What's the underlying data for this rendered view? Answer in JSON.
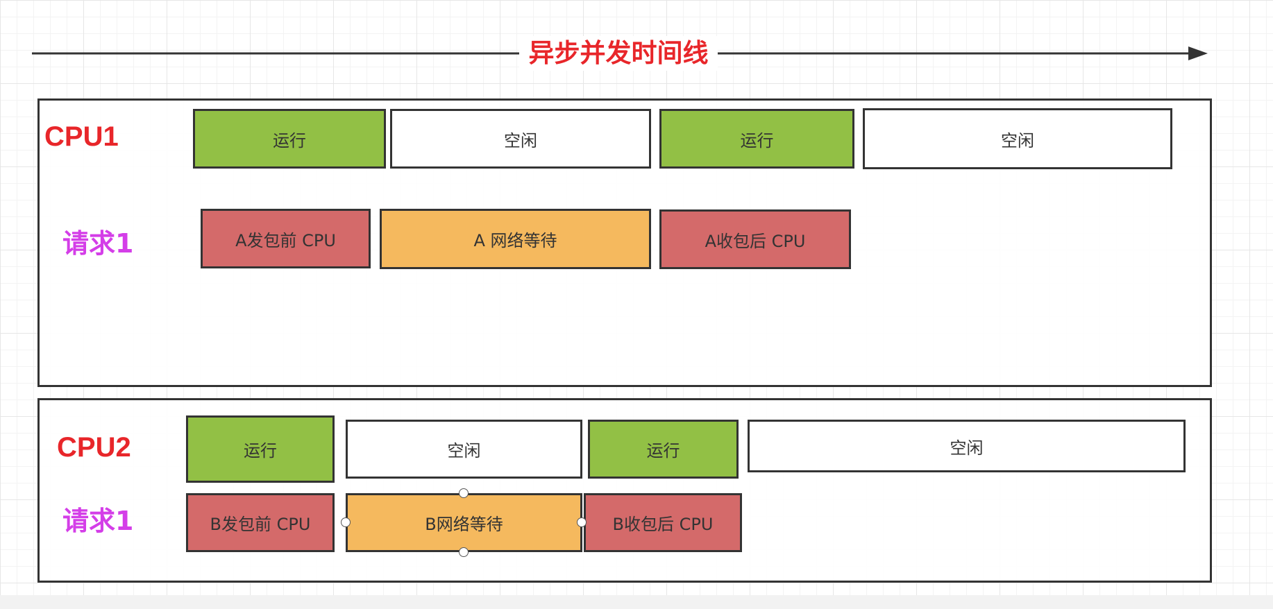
{
  "timeline": {
    "title": "异步并发时间线"
  },
  "panel1": {
    "cpu_label": "CPU1",
    "request_label": "请求1",
    "cpu_blocks": [
      {
        "label": "运行",
        "state": "running"
      },
      {
        "label": "空闲",
        "state": "idle"
      },
      {
        "label": "运行",
        "state": "running"
      },
      {
        "label": "空闲",
        "state": "idle"
      }
    ],
    "request_blocks": [
      {
        "label": "A发包前 CPU",
        "kind": "cpu"
      },
      {
        "label": "A 网络等待",
        "kind": "wait"
      },
      {
        "label": "A收包后 CPU",
        "kind": "cpu"
      }
    ]
  },
  "panel2": {
    "cpu_label": "CPU2",
    "request_label": "请求1",
    "cpu_blocks": [
      {
        "label": "运行",
        "state": "running"
      },
      {
        "label": "空闲",
        "state": "idle"
      },
      {
        "label": "运行",
        "state": "running"
      },
      {
        "label": "空闲",
        "state": "idle"
      }
    ],
    "request_blocks": [
      {
        "label": "B发包前 CPU",
        "kind": "cpu"
      },
      {
        "label": "B网络等待",
        "kind": "wait",
        "selected": true
      },
      {
        "label": "B收包后 CPU",
        "kind": "cpu"
      }
    ]
  },
  "colors": {
    "running": "#92c045",
    "idle": "#ffffff",
    "cpu_work": "#d46a6a",
    "network_wait": "#f5b95e",
    "cpu_label": "#e8262a",
    "request_label": "#d43ee8",
    "outline": "#333333"
  }
}
